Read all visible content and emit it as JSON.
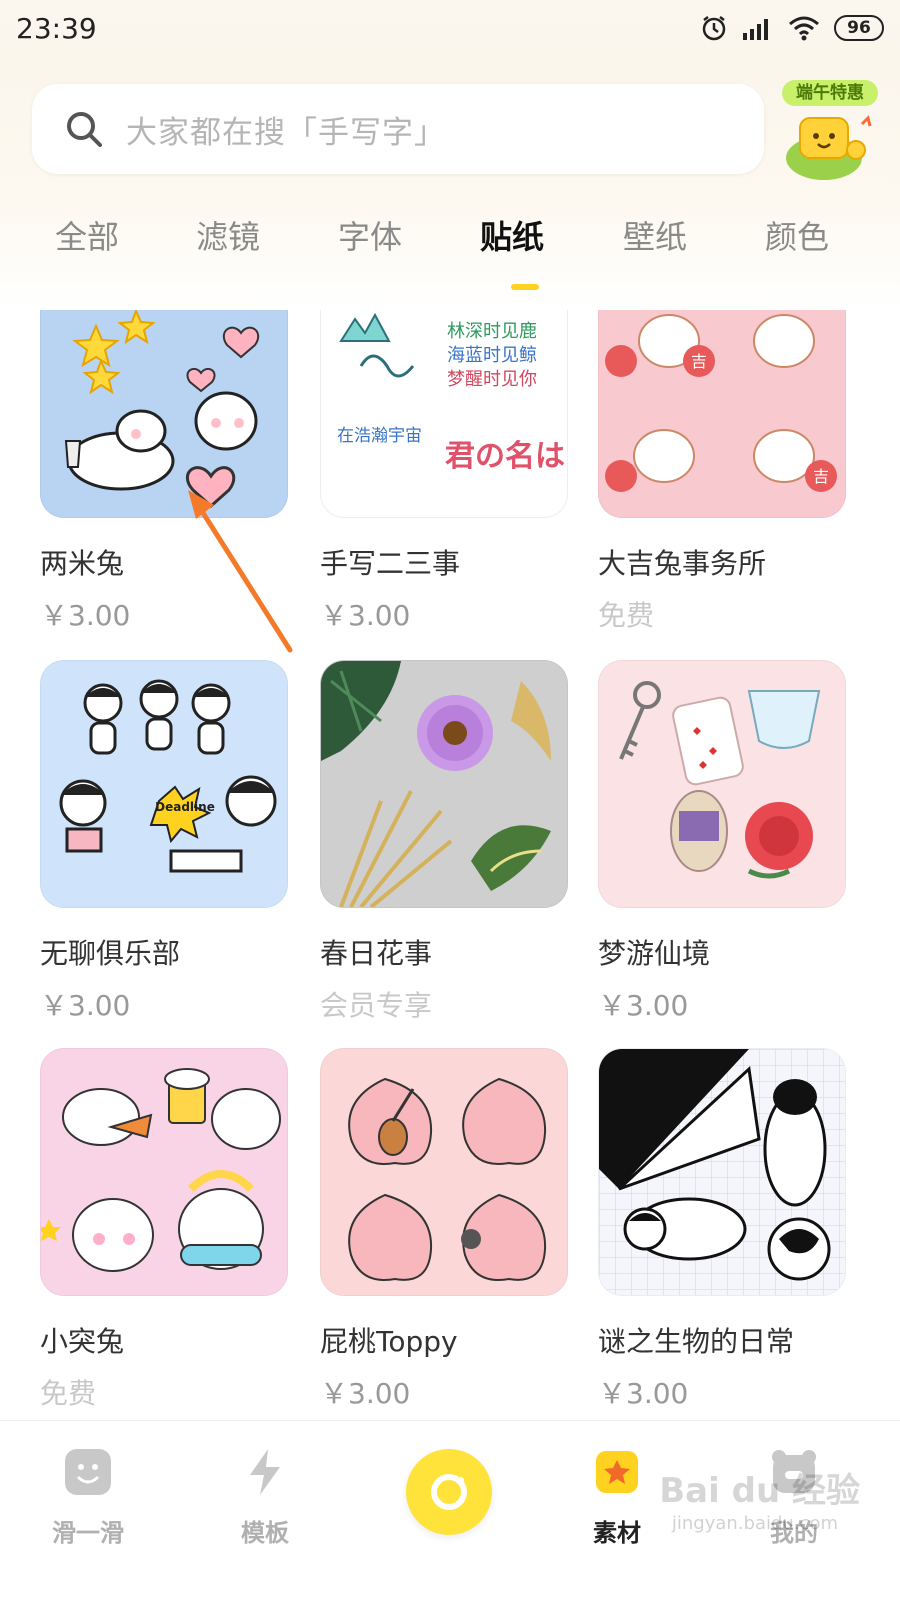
{
  "status_bar": {
    "time": "23:39",
    "battery": "96",
    "icons": [
      "alarm-icon",
      "signal-icon",
      "wifi-icon",
      "battery-icon"
    ]
  },
  "search": {
    "placeholder": "大家都在搜「手写字」",
    "icon": "search-icon"
  },
  "promo": {
    "label": "端午特惠"
  },
  "tabs": [
    {
      "label": "全部"
    },
    {
      "label": "滤镜"
    },
    {
      "label": "字体"
    },
    {
      "label": "贴纸",
      "active": true
    },
    {
      "label": "壁纸"
    },
    {
      "label": "颜色"
    }
  ],
  "accent_color": "#ffd21f",
  "stickers": [
    {
      "name": "两米兔",
      "price": "￥3.00"
    },
    {
      "name": "手写二三事",
      "price": "￥3.00"
    },
    {
      "name": "大吉兔事务所",
      "price": "免费"
    },
    {
      "name": "无聊俱乐部",
      "price": "￥3.00"
    },
    {
      "name": "春日花事",
      "price": "会员专享"
    },
    {
      "name": "梦游仙境",
      "price": "￥3.00"
    },
    {
      "name": "小突兔",
      "price": "免费"
    },
    {
      "name": "屁桃Toppy",
      "price": "￥3.00"
    },
    {
      "name": "谜之生物的日常",
      "price": "￥3.00"
    }
  ],
  "sticker_art_text": {
    "handwriting": [
      "林深时见鹿",
      "海蓝时见鲸",
      "梦醒时见你",
      "在浩瀚宇宙",
      "君の名は"
    ],
    "ji": "吉",
    "deadline": "Deadline"
  },
  "bottom_nav": [
    {
      "label": "滑一滑",
      "icon": "smiley-icon"
    },
    {
      "label": "模板",
      "icon": "lightning-icon"
    },
    {
      "label": "",
      "icon": "camera-icon"
    },
    {
      "label": "素材",
      "icon": "star-bag-icon",
      "active": true
    },
    {
      "label": "我的",
      "icon": "bear-icon"
    }
  ],
  "watermark": {
    "main": "Bai du 经验",
    "sub": "jingyan.baidu.com"
  }
}
